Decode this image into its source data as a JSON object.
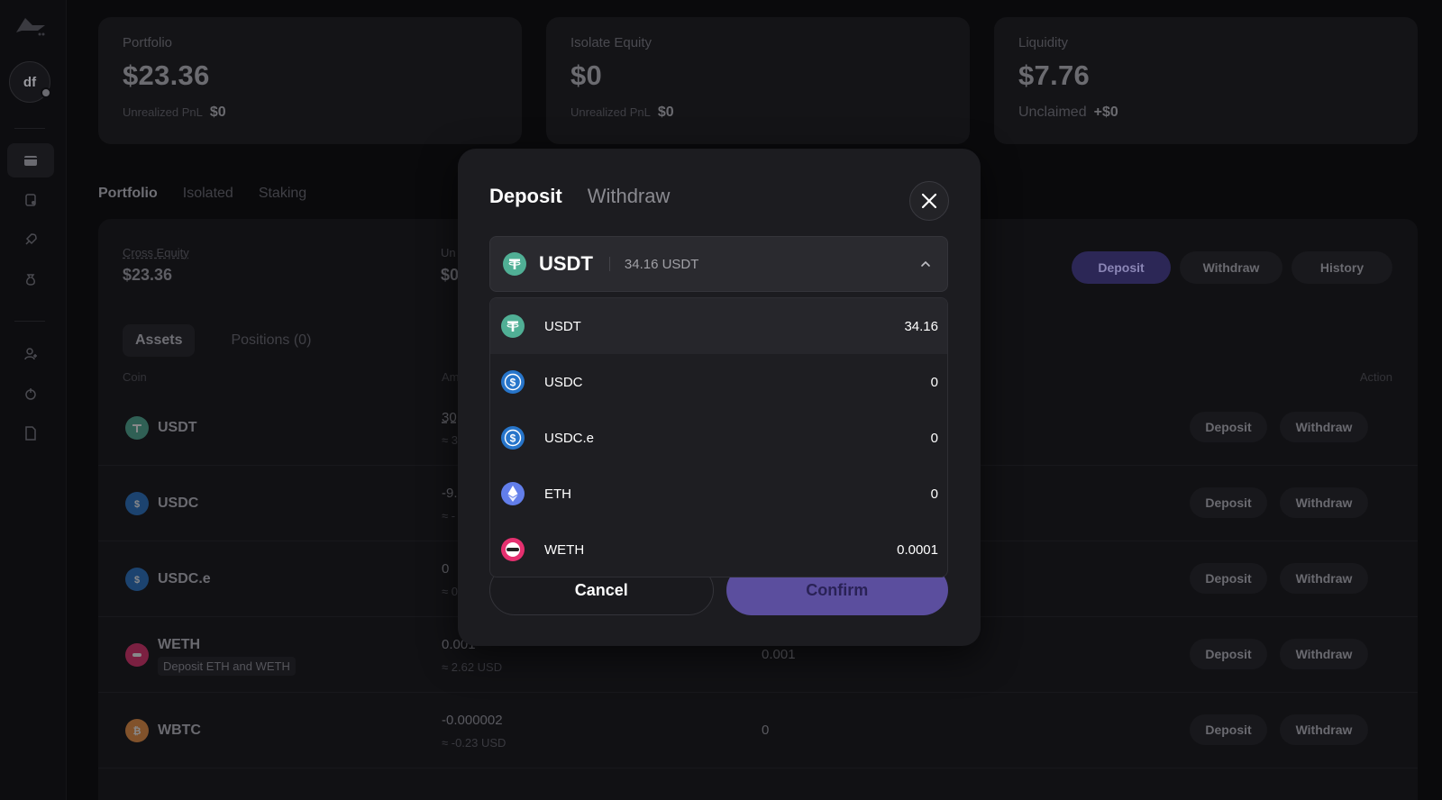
{
  "sidebar": {
    "avatar_initials": "df"
  },
  "stats": [
    {
      "label": "Portfolio",
      "value": "$23.36",
      "sub_label": "Unrealized PnL",
      "sub_value": "$0"
    },
    {
      "label": "Isolate Equity",
      "value": "$0",
      "sub_label": "Unrealized PnL",
      "sub_value": "$0"
    },
    {
      "label": "Liquidity",
      "value": "$7.76",
      "sub_label": "Unclaimed",
      "sub_value": "+$0"
    }
  ],
  "page_tabs": [
    "Portfolio",
    "Isolated",
    "Staking"
  ],
  "panel": {
    "cross_equity_label": "Cross Equity",
    "cross_equity_value": "$23.36",
    "unrealized_label": "Un",
    "unrealized_value": "$0",
    "actions": {
      "deposit": "Deposit",
      "withdraw": "Withdraw",
      "history": "History"
    },
    "sub_tabs": [
      "Assets",
      "Positions (0)"
    ],
    "headers": {
      "coin": "Coin",
      "amount": "Am",
      "action": "Action"
    }
  },
  "assets": [
    {
      "coin": "USDT",
      "amount": "30",
      "amount_sub": "≈ 3",
      "col3": "",
      "tag": ""
    },
    {
      "coin": "USDC",
      "amount": "-9.",
      "amount_sub": "≈ -",
      "col3": "",
      "tag": ""
    },
    {
      "coin": "USDC.e",
      "amount": "0",
      "amount_sub": "≈ 0",
      "col3": "",
      "tag": ""
    },
    {
      "coin": "WETH",
      "amount": "0.001",
      "amount_sub": "≈ 2.62 USD",
      "col3": "0.001",
      "tag": "Deposit ETH and WETH"
    },
    {
      "coin": "WBTC",
      "amount": "-0.000002",
      "amount_sub": "≈ -0.23 USD",
      "col3": "0",
      "tag": ""
    }
  ],
  "row_actions": {
    "deposit": "Deposit",
    "withdraw": "Withdraw"
  },
  "modal": {
    "tabs": [
      "Deposit",
      "Withdraw"
    ],
    "selected_token": "USDT",
    "selected_balance": "34.16 USDT",
    "tokens": [
      {
        "name": "USDT",
        "balance": "34.16",
        "icon": "usdt-icon"
      },
      {
        "name": "USDC",
        "balance": "0",
        "icon": "usdc-icon"
      },
      {
        "name": "USDC.e",
        "balance": "0",
        "icon": "usdc-icon"
      },
      {
        "name": "ETH",
        "balance": "0",
        "icon": "eth-icon"
      },
      {
        "name": "WETH",
        "balance": "0.0001",
        "icon": "weth-icon"
      }
    ],
    "cancel_label": "Cancel",
    "confirm_label": "Confirm"
  },
  "colors": {
    "accent": "#5b4e9e",
    "usdt": "#50af95",
    "usdc": "#2775ca",
    "eth": "#627eea",
    "weth": "#e5306f"
  }
}
